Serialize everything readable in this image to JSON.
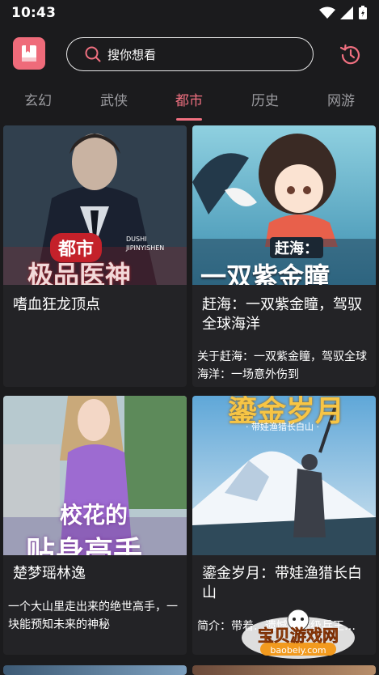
{
  "status": {
    "time": "10:43"
  },
  "search": {
    "placeholder": "搜你想看"
  },
  "tabs": [
    {
      "label": "玄幻"
    },
    {
      "label": "武侠"
    },
    {
      "label": "都市",
      "active": true
    },
    {
      "label": "历史"
    },
    {
      "label": "网游"
    }
  ],
  "books": [
    {
      "title": "嗜血狂龙顶点",
      "desc": "",
      "cover_text": [
        "都市",
        "极品医神",
        "DUSHI",
        "JIPINYISHEN"
      ]
    },
    {
      "title": "赶海：一双紫金瞳，驾驭全球海洋",
      "desc": "关于赶海：一双紫金瞳，驾驭全球海洋：一场意外伤到",
      "cover_text": [
        "赶海：",
        "一双紫金瞳"
      ]
    },
    {
      "title": "楚梦瑶林逸",
      "desc": "一个大山里走出来的绝世高手，一块能预知未来的神秘",
      "cover_text": [
        "校花的",
        "贴身高手"
      ]
    },
    {
      "title": "鎏金岁月：带娃渔猎长白山",
      "desc": "简介：带着…遗憾的超级兵王…",
      "cover_text": [
        "鎏金岁月",
        "· 带娃渔猎长白山 ·"
      ]
    }
  ],
  "watermark": {
    "text": "宝贝游戏网",
    "url": "baobeiy.com"
  },
  "colors": {
    "accent": "#f07080",
    "background": "#1b1b1d",
    "logo": "#ef6b7a"
  }
}
